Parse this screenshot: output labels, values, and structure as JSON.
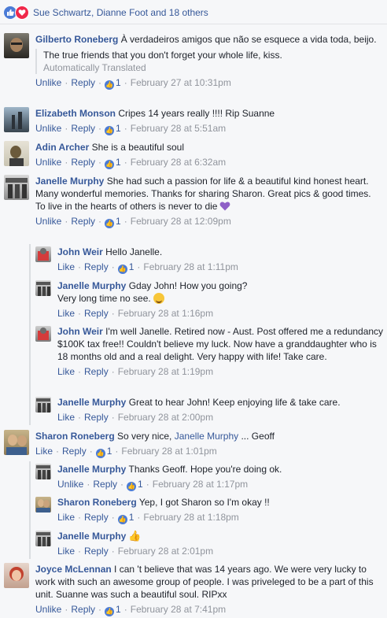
{
  "reactions": {
    "names": "Sue Schwartz, Dianne Foot and 18 others"
  },
  "actions": {
    "like": "Like",
    "unlike": "Unlike",
    "reply": "Reply",
    "sep": "·"
  },
  "comments": [
    {
      "name": "Gilberto Roneberg",
      "text": "À verdadeiros amigos que não se esquece a vida toda, beijo.",
      "translation": "The true friends that you don't forget your whole life, kiss.",
      "translated_note": "Automatically Translated",
      "action": "Unlike",
      "likes": "1",
      "time": "February 27 at 10:31pm"
    },
    {
      "name": "Elizabeth Monson",
      "text": "Cripes 14 years really !!!! Rip Suanne",
      "action": "Unlike",
      "likes": "1",
      "time": "February 28 at 5:51am"
    },
    {
      "name": "Adin Archer",
      "text": "She is a beautiful soul",
      "action": "Unlike",
      "likes": "1",
      "time": "February 28 at 6:32am"
    },
    {
      "name": "Janelle Murphy",
      "text": "She had such a passion for life & a beautiful kind honest heart. Many wonderful memories. Thanks for sharing Sharon. Great pics & good times.",
      "text2": "To live in the hearts of others is never to die",
      "action": "Unlike",
      "likes": "1",
      "time": "February 28 at 12:09pm"
    },
    {
      "name": "John Weir",
      "text": "Hello Janelle.",
      "action": "Like",
      "likes": "1",
      "time": "February 28 at 1:11pm"
    },
    {
      "name": "Janelle Murphy",
      "text": "Gday John! How you going?",
      "text2": "Very long time no see.",
      "action": "Like",
      "time": "February 28 at 1:16pm"
    },
    {
      "name": "John Weir",
      "text": "I'm well Janelle. Retired now - Aust. Post offered me a redundancy $100K tax free!! Couldn't believe my luck. Now have a granddaughter who is 18 months old and a real delight. Very happy with life! Take care.",
      "action": "Like",
      "time": "February 28 at 1:19pm"
    },
    {
      "name": "Janelle Murphy",
      "text": "Great to hear John! Keep enjoying life & take care.",
      "action": "Like",
      "time": "February 28 at 2:00pm"
    },
    {
      "name": "Sharon Roneberg",
      "text": "So very nice,",
      "mention": "Janelle Murphy",
      "text_after": "... Geoff",
      "action": "Like",
      "likes": "1",
      "time": "February 28 at 1:01pm"
    },
    {
      "name": "Janelle Murphy",
      "text": "Thanks Geoff. Hope you're doing ok.",
      "action": "Unlike",
      "likes": "1",
      "time": "February 28 at 1:17pm"
    },
    {
      "name": "Sharon Roneberg",
      "text": "Yep, I got Sharon so I'm okay !!",
      "action": "Like",
      "likes": "1",
      "time": "February 28 at 1:18pm"
    },
    {
      "name": "Janelle Murphy",
      "text": "",
      "action": "Like",
      "time": "February 28 at 2:01pm"
    },
    {
      "name": "Joyce McLennan",
      "text": "I can 't believe that was 14 years ago. We were very lucky to work with such an awesome group of people. I was priveleged to be a part of this unit. Suanne was such a beautiful soul. RIPxx",
      "action": "Unlike",
      "likes": "1",
      "time": "February 28 at 7:41pm"
    }
  ]
}
